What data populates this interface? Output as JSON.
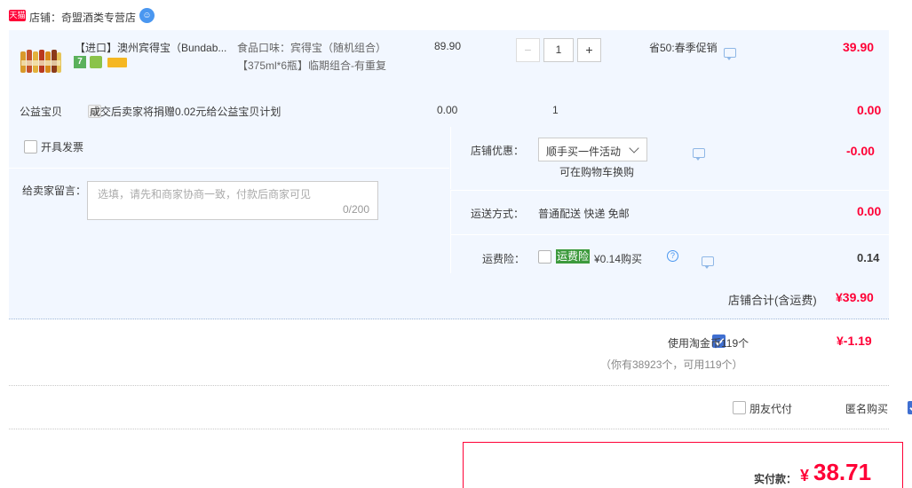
{
  "shop": {
    "badge": "天猫",
    "label": "店铺：奇盟酒类专营店",
    "service_icon_glyph": "☺"
  },
  "item": {
    "title": "【进口】澳州宾得宝（Bundab...",
    "flavor": "食品口味：宾得宝（随机组合）",
    "spec": "【375ml*6瓶】临期组合-有重复",
    "unit_price": "89.90",
    "quantity": "1",
    "minus": "−",
    "plus": "+",
    "promo": "省50:春季促销",
    "subtotal": "39.90",
    "badge_7": "7"
  },
  "charity": {
    "label": "公益宝贝",
    "text": "成交后卖家将捐赠0.02元给公益宝贝计划",
    "price": "0.00",
    "qty": "1",
    "subtotal": "0.00"
  },
  "invoice": {
    "label": "开具发票"
  },
  "message": {
    "label": "给卖家留言：",
    "placeholder": "选填，请先和商家协商一致，付款后商家可见",
    "counter": "0/200"
  },
  "shop_discount": {
    "label": "店铺优惠：",
    "selected": "顺手买一件活动",
    "hint": "可在购物车换购",
    "amount": "-0.00"
  },
  "shipping": {
    "label": "运送方式：",
    "value": "普通配送 快递 免邮",
    "amount": "0.00"
  },
  "insurance": {
    "label": "运费险：",
    "tag": "运费险",
    "text": "¥0.14购买",
    "amount": "0.14"
  },
  "shop_total": {
    "label": "店铺合计(含运费)",
    "amount": "¥39.90"
  },
  "coins": {
    "label": "使用淘金币119个",
    "detail": "（你有38923个，可用119个）",
    "amount": "¥-1.19"
  },
  "options": {
    "friend_pay": "朋友代付",
    "anonymous": "匿名购买"
  },
  "payment": {
    "label": "实付款：",
    "currency": "¥",
    "amount": "38.71"
  },
  "colors": {
    "accent_red": "#ff0036",
    "panel_blue": "#f2f7ff",
    "checkbox_blue": "#3f6fd1",
    "tag_green": "#3d9a3d"
  }
}
